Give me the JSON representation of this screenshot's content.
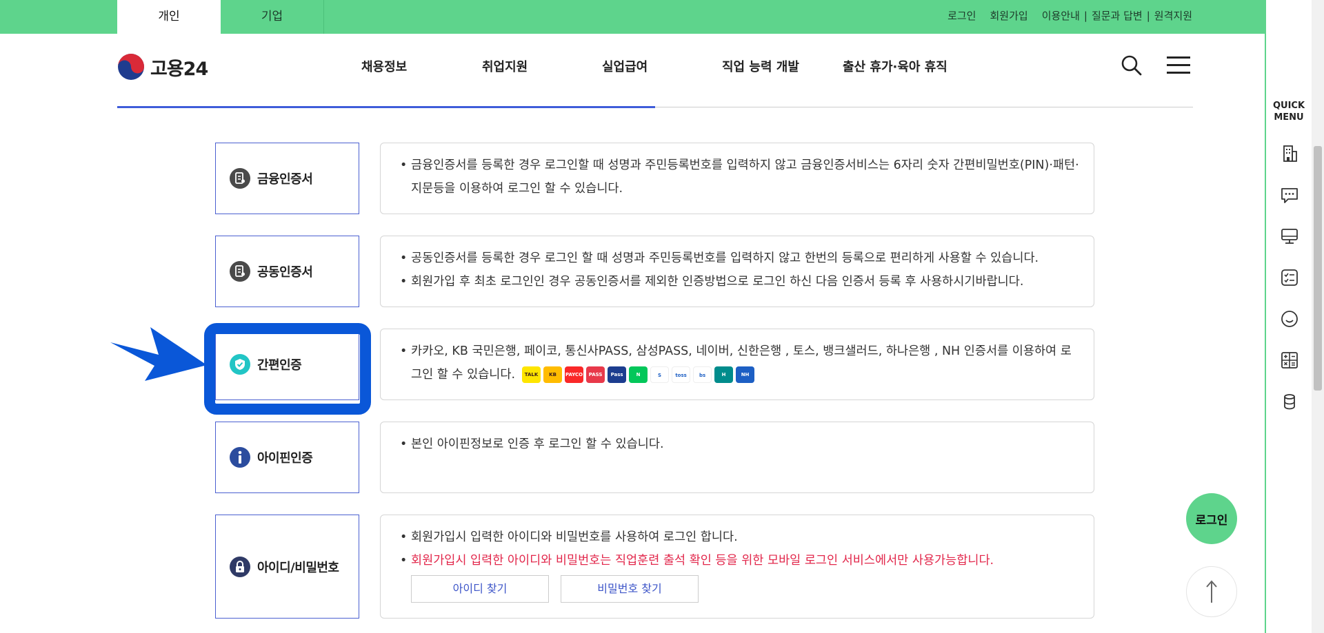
{
  "topbar": {
    "tabs": [
      {
        "label": "개인",
        "active": true
      },
      {
        "label": "기업",
        "active": false
      }
    ],
    "links": [
      "로그인",
      "회원가입",
      "이용안내",
      "질문과 답변",
      "원격지원"
    ],
    "color": "#5ed48c"
  },
  "header": {
    "logo_text": "고용24",
    "nav": [
      "채용정보",
      "취업지원",
      "실업급여",
      "직업 능력 개발",
      "출산 휴가·육아 휴직"
    ],
    "search_icon": "search-icon",
    "menu_icon": "hamburger-menu-icon"
  },
  "methods": [
    {
      "label": "금융인증서",
      "icon": "certificate-icon",
      "items": [
        {
          "text": "금융인증서를 등록한 경우 로그인할 때 성명과 주민등록번호를 입력하지 않고 금융인증서비스는 6자리 숫자 간편비밀번호(PIN)·패턴·지문등을 이용하여 로그인 할 수 있습니다."
        }
      ]
    },
    {
      "label": "공동인증서",
      "icon": "certificate-icon",
      "items": [
        {
          "text": "공동인증서를 등록한 경우 로그인 할 때 성명과 주민등록번호를 입력하지 않고 한번의 등록으로 편리하게 사용할 수 있습니다."
        },
        {
          "text": "회원가입 후 최초 로그인인 경우 공동인증서를 제외한 인증방법으로 로그인 하신 다음 인증서 등록 후 사용하시기바랍니다."
        }
      ]
    },
    {
      "label": "간편인증",
      "icon": "shield-check-icon",
      "items": [
        {
          "text": "카카오, KB 국민은행, 페이코, 통신사PASS, 삼성PASS, 네이버, 신한은행 , 토스, 뱅크샐러드, 하나은행 , NH 인증서를 이용하여 로그인 할 수 있습니다."
        }
      ],
      "provider_icons": [
        {
          "name": "kakao-talk-icon",
          "label": "TALK",
          "color": "#fee500"
        },
        {
          "name": "kb-bank-icon",
          "label": "KB",
          "color": "#ffbc00"
        },
        {
          "name": "payco-icon",
          "label": "PAYCO",
          "color": "#fa2828"
        },
        {
          "name": "pass-icon",
          "label": "PASS",
          "color": "#e8394a"
        },
        {
          "name": "samsung-pass-icon",
          "label": "Pass",
          "color": "#1c3d8f"
        },
        {
          "name": "naver-icon",
          "label": "N",
          "color": "#03c75a"
        },
        {
          "name": "shinhan-bank-icon",
          "label": "S",
          "color": "#ffffff"
        },
        {
          "name": "toss-icon",
          "label": "toss",
          "color": "#ffffff"
        },
        {
          "name": "banksalad-icon",
          "label": "bs",
          "color": "#ffffff"
        },
        {
          "name": "hana-bank-icon",
          "label": "H",
          "color": "#008c8c"
        },
        {
          "name": "nh-bank-icon",
          "label": "NH",
          "color": "#1d5fc4"
        }
      ],
      "highlight_color": "#0a57d8"
    },
    {
      "label": "아이핀인증",
      "icon": "info-icon",
      "items": [
        {
          "text": "본인 아이핀정보로 인증 후 로그인 할 수 있습니다."
        }
      ]
    },
    {
      "label": "아이디/비밀번호",
      "icon": "lock-icon",
      "items": [
        {
          "text": "회원가입시 입력한 아이디와 비밀번호를 사용하여 로그인 합니다."
        },
        {
          "text": "회원가입시 입력한 아이디와 비밀번호는 직업훈련 출석 확인 등을 위한 모바일 로그인 서비스에서만 사용가능합니다.",
          "color": "#e2274b"
        }
      ],
      "buttons": [
        "아이디 찾기",
        "비밀번호 찾기"
      ]
    }
  ],
  "quick_menu": {
    "title_line1": "QUICK",
    "title_line2": "MENU",
    "icons": [
      "building-icon",
      "chat-bubble-icon",
      "monitor-icon",
      "checklist-icon",
      "smile-icon",
      "calculator-icon",
      "database-icon"
    ]
  },
  "floating": {
    "login_label": "로그인",
    "top_icon": "arrow-up-icon"
  }
}
